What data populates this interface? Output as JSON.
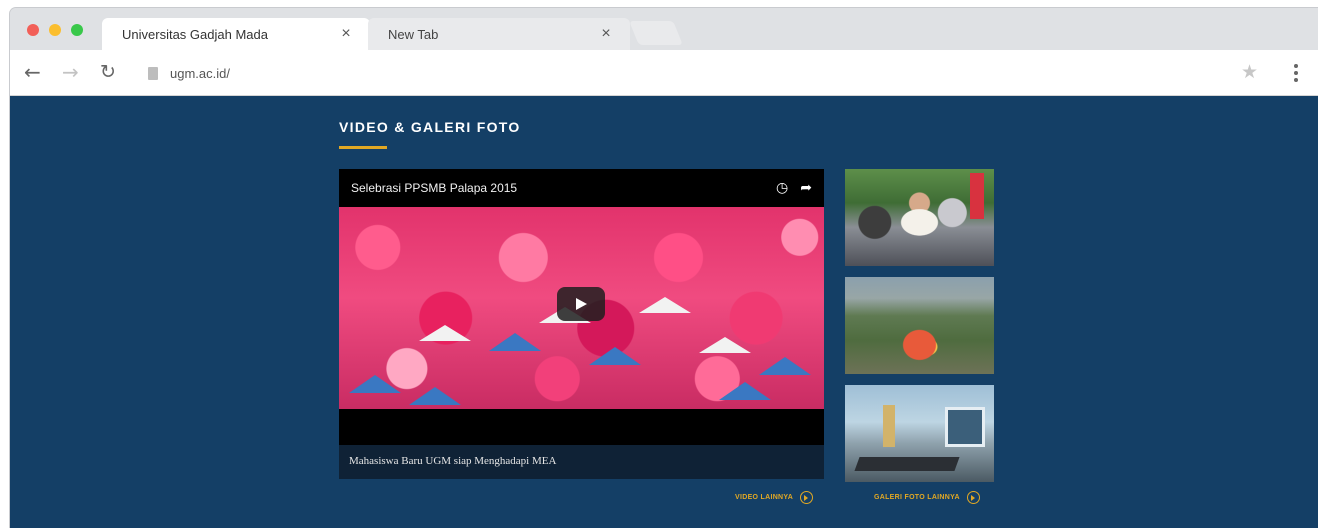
{
  "browser": {
    "tabs": [
      {
        "label": "Universitas Gadjah Mada",
        "close": "×",
        "active": true
      },
      {
        "label": "New Tab",
        "close": "×",
        "active": false
      }
    ],
    "toolbar": {
      "back_icon": "←",
      "forward_icon": "→",
      "reload_icon": "↻",
      "url": "ugm.ac.id/",
      "star_icon": "★"
    }
  },
  "section": {
    "title": "VIDEO & GALERI FOTO",
    "accent_color": "#e1a824",
    "background_color": "#143f66"
  },
  "video": {
    "title": "Selebrasi PPSMB Palapa 2015",
    "clock_icon": "◷",
    "share_icon": "➦",
    "caption": "Mahasiswa Baru UGM siap Menghadapi MEA",
    "more_label": "VIDEO LAINNYA"
  },
  "gallery": {
    "thumbnails": [
      "event-photo",
      "aerial-photo",
      "interior-photo"
    ],
    "more_label": "GALERI FOTO LAINNYA"
  }
}
